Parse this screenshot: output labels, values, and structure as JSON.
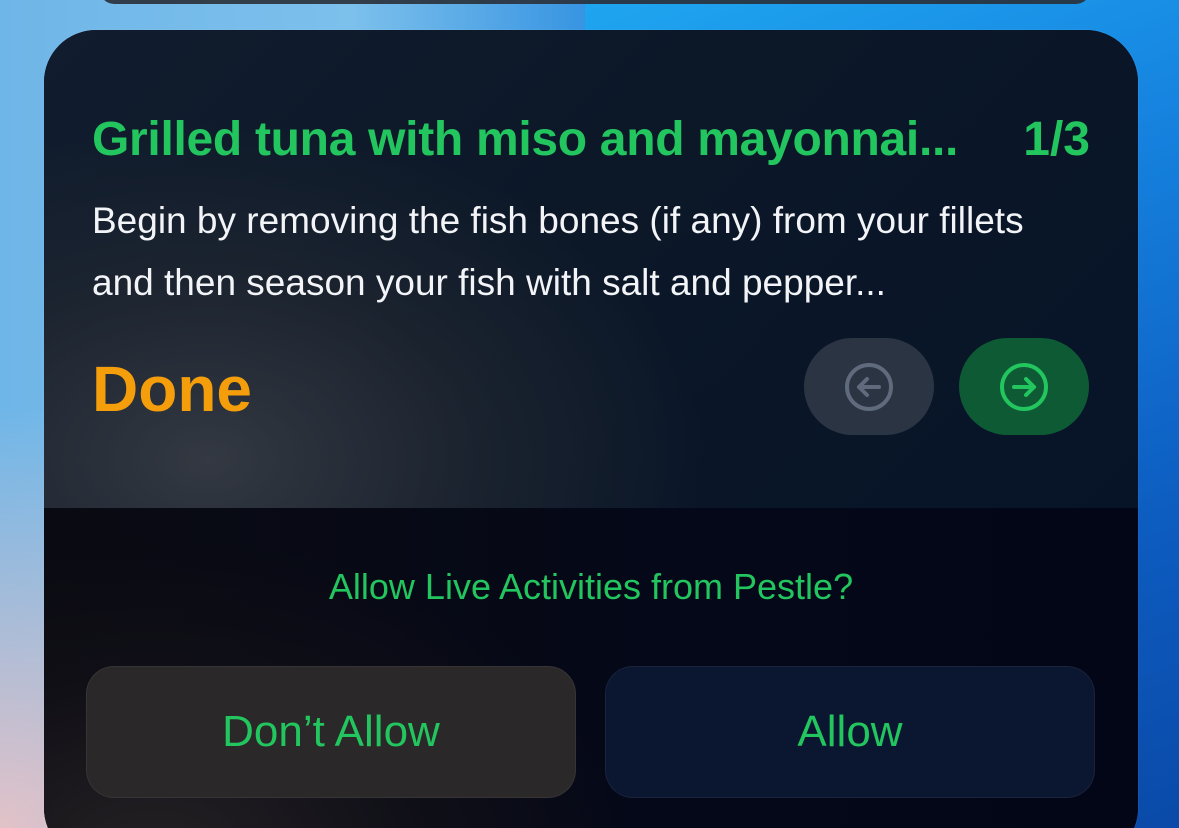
{
  "live_activity": {
    "recipe_title": "Grilled tuna with miso and mayonnai...",
    "step_counter": "1/3",
    "step_text": "Begin by removing the fish bones (if any) from your fillets and then season your fish with salt and pepper...",
    "done_label": "Done",
    "icons": {
      "previous": "arrow-left-circle-icon",
      "next": "arrow-right-circle-icon"
    }
  },
  "permission_prompt": {
    "question": "Allow Live Activities from Pestle?",
    "deny_label": "Don’t Allow",
    "allow_label": "Allow"
  },
  "colors": {
    "accent_green": "#22c55e",
    "done_orange": "#f59e0b",
    "next_button_bg": "#0d5a35",
    "prev_button_bg": "#2b3442"
  }
}
